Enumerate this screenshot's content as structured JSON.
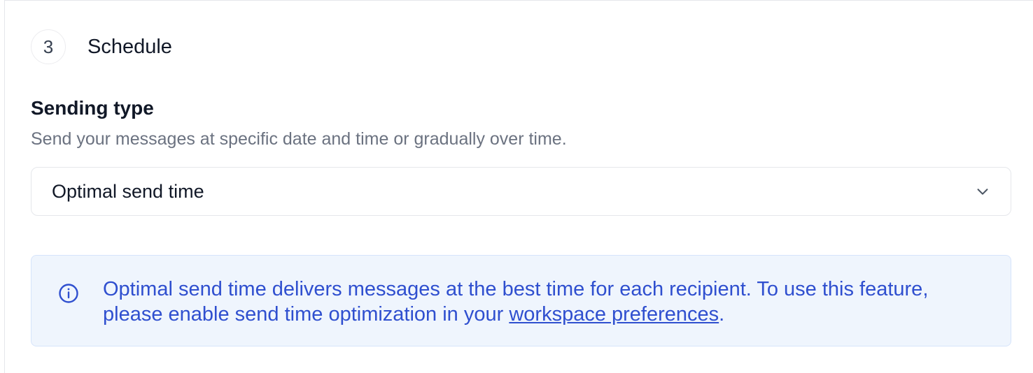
{
  "step": {
    "number": "3",
    "title": "Schedule"
  },
  "sending_type": {
    "label": "Sending type",
    "help": "Send your messages at specific date and time or gradually over time.",
    "selected": "Optimal send time"
  },
  "info": {
    "text_before_link": "Optimal send time delivers messages at the best time for each recipient. To use this feature, please enable send time optimization in your ",
    "link_label": "workspace preferences",
    "text_after_link": ".",
    "icon": "info-circle-icon"
  },
  "colors": {
    "info_text": "#2f4fcf",
    "info_background": "#eff5fd",
    "info_border": "#d6e4fb"
  }
}
